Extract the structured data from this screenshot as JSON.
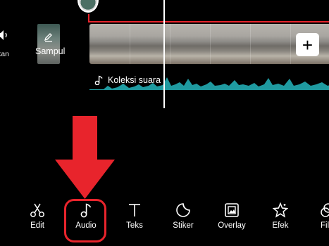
{
  "timeline": {
    "mute_label": "kan",
    "cover_label": "Sampul",
    "audio_track_label": "Koleksi suara",
    "add_clip_symbol": "+"
  },
  "toolbar": {
    "items": [
      {
        "label": "Edit",
        "icon": "scissors-icon"
      },
      {
        "label": "Audio",
        "icon": "music-note-icon"
      },
      {
        "label": "Teks",
        "icon": "text-icon"
      },
      {
        "label": "Stiker",
        "icon": "sticker-icon"
      },
      {
        "label": "Overlay",
        "icon": "overlay-icon"
      },
      {
        "label": "Efek",
        "icon": "star-effect-icon"
      },
      {
        "label": "Fil",
        "icon": "filter-icon"
      }
    ]
  },
  "colors": {
    "accent_red": "#e8242c",
    "waveform": "#1f9aa0",
    "background": "#000000"
  }
}
